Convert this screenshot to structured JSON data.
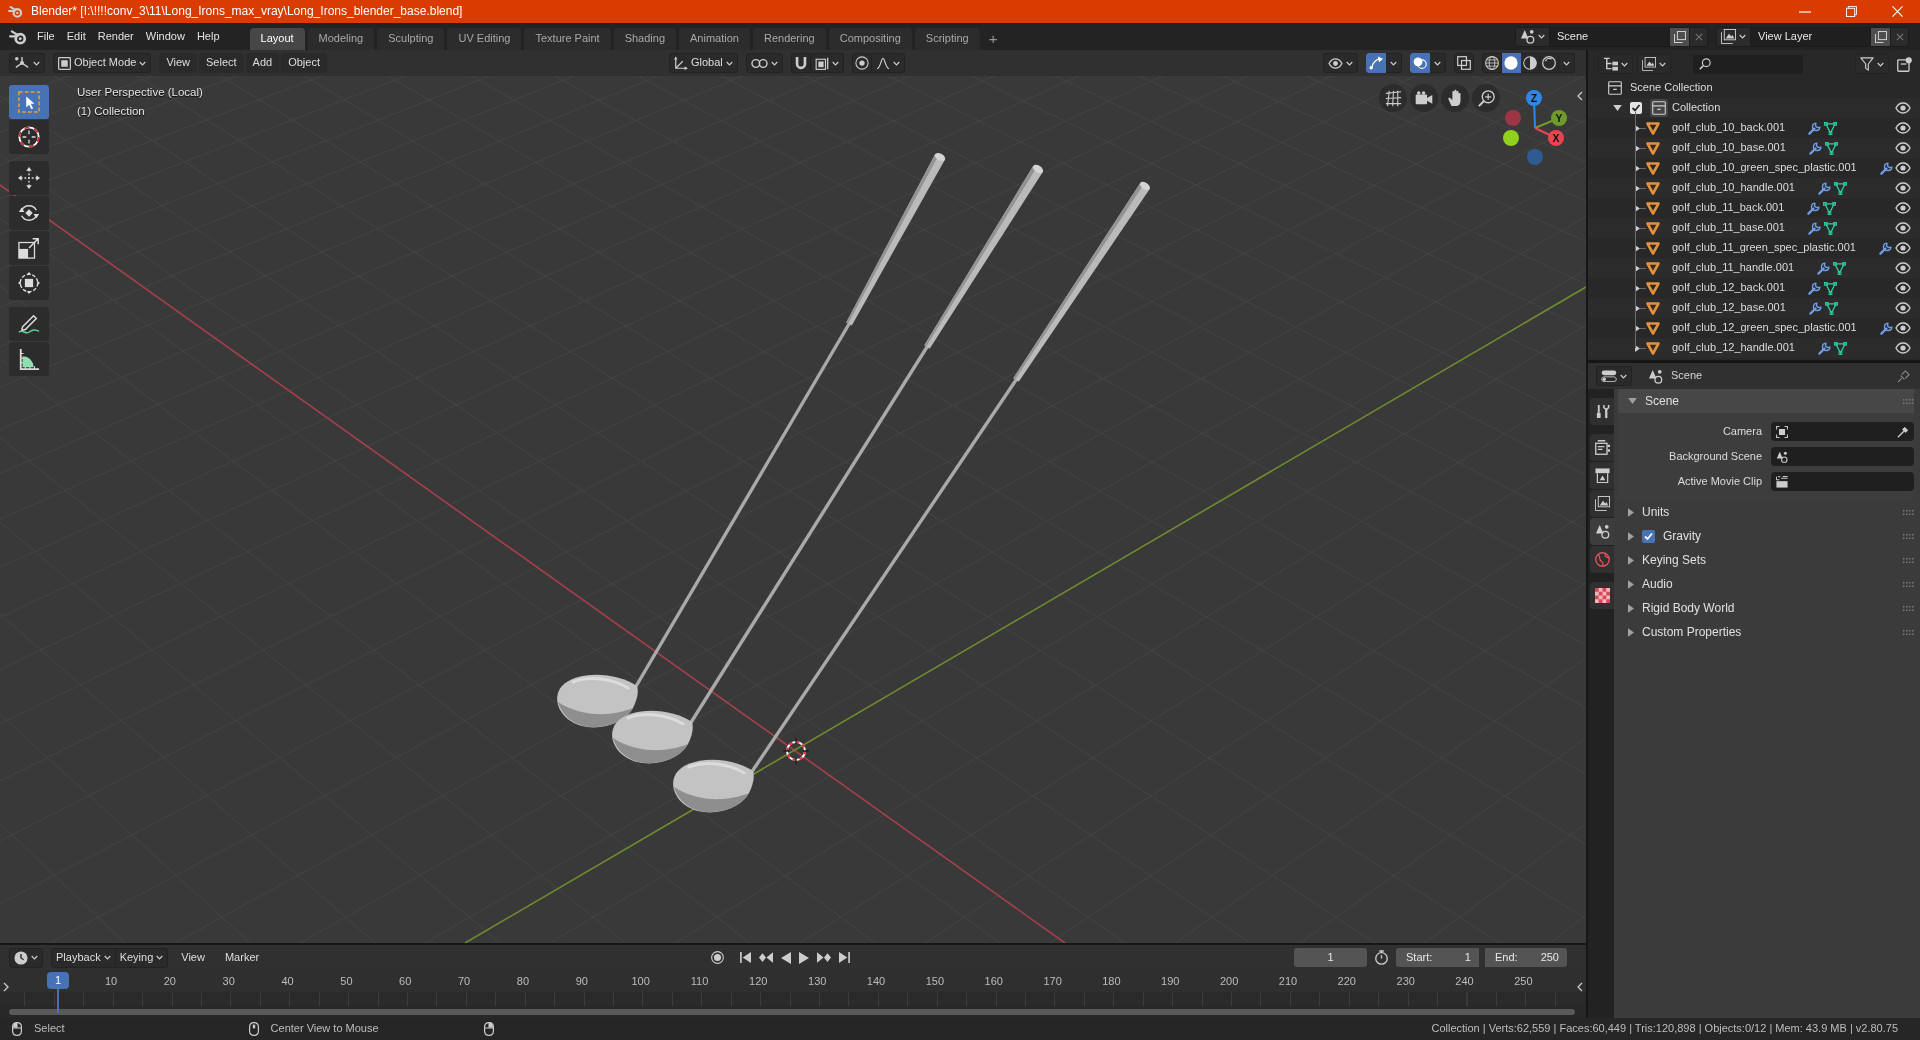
{
  "title_bar": {
    "title": "Blender* [I:\\!!!!conv_3\\11\\Long_Irons_max_vray\\Long_Irons_blender_base.blend]"
  },
  "top_bar": {
    "menus": [
      "File",
      "Edit",
      "Render",
      "Window",
      "Help"
    ],
    "workspaces": [
      {
        "label": "Layout",
        "selected": true
      },
      {
        "label": "Modeling",
        "selected": false
      },
      {
        "label": "Sculpting",
        "selected": false
      },
      {
        "label": "UV Editing",
        "selected": false
      },
      {
        "label": "Texture Paint",
        "selected": false
      },
      {
        "label": "Shading",
        "selected": false
      },
      {
        "label": "Animation",
        "selected": false
      },
      {
        "label": "Rendering",
        "selected": false
      },
      {
        "label": "Compositing",
        "selected": false
      },
      {
        "label": "Scripting",
        "selected": false
      }
    ],
    "add_workspace": "+",
    "scene": "Scene",
    "view_layer": "View Layer"
  },
  "viewport": {
    "header": {
      "mode": "Object Mode",
      "menus": [
        "View",
        "Select",
        "Add",
        "Object"
      ],
      "orientation": "Global",
      "toggles": [
        {
          "kind": "snap",
          "on": false
        },
        {
          "kind": "proportional",
          "on": false
        },
        {
          "kind": "gizmos",
          "on": true
        },
        {
          "kind": "overlays",
          "on": true
        },
        {
          "kind": "xray",
          "on": false
        }
      ],
      "shading": [
        {
          "kind": "wireframe",
          "selected": false
        },
        {
          "kind": "solid",
          "selected": true
        },
        {
          "kind": "material",
          "selected": false
        },
        {
          "kind": "rendered",
          "selected": false
        }
      ]
    },
    "tools": [
      {
        "kind": "select_box",
        "selected": true
      },
      {
        "kind": "cursor",
        "selected": false
      },
      {
        "kind": "move",
        "selected": false
      },
      {
        "kind": "rotate",
        "selected": false
      },
      {
        "kind": "scale",
        "selected": false
      },
      {
        "kind": "transform",
        "selected": false
      },
      {
        "kind": "annotate",
        "selected": false
      },
      {
        "kind": "measure",
        "selected": false
      }
    ],
    "view_name": "User Perspective (Local)",
    "collection_name": "(1) Collection",
    "gizmo": [
      {
        "kind": "positive",
        "label": "Z",
        "color": "#2f86e4"
      },
      {
        "kind": "negative",
        "color": "#9c3644"
      },
      {
        "kind": "positive",
        "label": "Y",
        "color": "#6f9a2c"
      },
      {
        "kind": "negative",
        "color": "#8fd11e"
      },
      {
        "kind": "positive",
        "label": "X",
        "color": "#e8434f"
      },
      {
        "kind": "negative",
        "color": "#2e5c92"
      }
    ]
  },
  "outliner": {
    "root": "Scene Collection",
    "collections": [
      {
        "name": "Collection",
        "checked": true,
        "expanded": true,
        "children": [
          {
            "name": "golf_club_10_back.001",
            "expanded": false
          },
          {
            "name": "golf_club_10_base.001",
            "expanded": false
          },
          {
            "name": "golf_club_10_green_spec_plastic.001",
            "expanded": false
          },
          {
            "name": "golf_club_10_handle.001",
            "expanded": false
          },
          {
            "name": "golf_club_11_back.001",
            "expanded": false
          },
          {
            "name": "golf_club_11_base.001",
            "expanded": false
          },
          {
            "name": "golf_club_11_green_spec_plastic.001",
            "expanded": false
          },
          {
            "name": "golf_club_11_handle.001",
            "expanded": false
          },
          {
            "name": "golf_club_12_back.001",
            "expanded": false
          },
          {
            "name": "golf_club_12_base.001",
            "expanded": false
          },
          {
            "name": "golf_club_12_green_spec_plastic.001",
            "expanded": false
          },
          {
            "name": "golf_club_12_handle.001",
            "expanded": false
          }
        ]
      }
    ]
  },
  "properties": {
    "context": "Scene",
    "tabs": [
      {
        "kind": "tool",
        "selected": false
      },
      {
        "kind": "render",
        "selected": false
      },
      {
        "kind": "output",
        "selected": false
      },
      {
        "kind": "view_layer",
        "selected": false
      },
      {
        "kind": "scene",
        "selected": true
      },
      {
        "kind": "world",
        "selected": false
      },
      {
        "kind": "texture",
        "selected": false
      }
    ],
    "panels": [
      {
        "title": "Scene",
        "expanded": true,
        "fields": [
          {
            "label": "Camera",
            "kind": "camera"
          },
          {
            "label": "Background Scene",
            "kind": "scene"
          },
          {
            "label": "Active Movie Clip",
            "kind": "clip"
          }
        ]
      },
      {
        "title": "Units",
        "expanded": false
      },
      {
        "title": "Gravity",
        "expanded": false,
        "toggle": {
          "checked": true
        }
      },
      {
        "title": "Keying Sets",
        "expanded": false
      },
      {
        "title": "Audio",
        "expanded": false
      },
      {
        "title": "Rigid Body World",
        "expanded": false
      },
      {
        "title": "Custom Properties",
        "expanded": false
      }
    ]
  },
  "timeline": {
    "menus": [
      {
        "label": "Playback",
        "kind": "dropdown"
      },
      {
        "label": "Keying",
        "kind": "dropdown"
      },
      {
        "label": "View",
        "kind": "menu"
      },
      {
        "label": "Marker",
        "kind": "menu"
      }
    ],
    "current_frame": "1",
    "start": {
      "label": "Start:",
      "value": "1"
    },
    "end": {
      "label": "End:",
      "value": "250"
    },
    "ruler": {
      "current": "1",
      "ticks": [
        "10",
        "20",
        "30",
        "40",
        "50",
        "60",
        "70",
        "80",
        "90",
        "100",
        "110",
        "120",
        "130",
        "140",
        "150",
        "160",
        "170",
        "180",
        "190",
        "200",
        "210",
        "220",
        "230",
        "240",
        "250"
      ]
    }
  },
  "status_bar": {
    "hints": [
      "Select",
      "Center View to Mouse"
    ],
    "stats": "Collection | Verts:62,559 | Faces:60,449 | Tris:120,898 | Objects:0/12 | Mem: 43.9 MB | v2.80.75"
  }
}
